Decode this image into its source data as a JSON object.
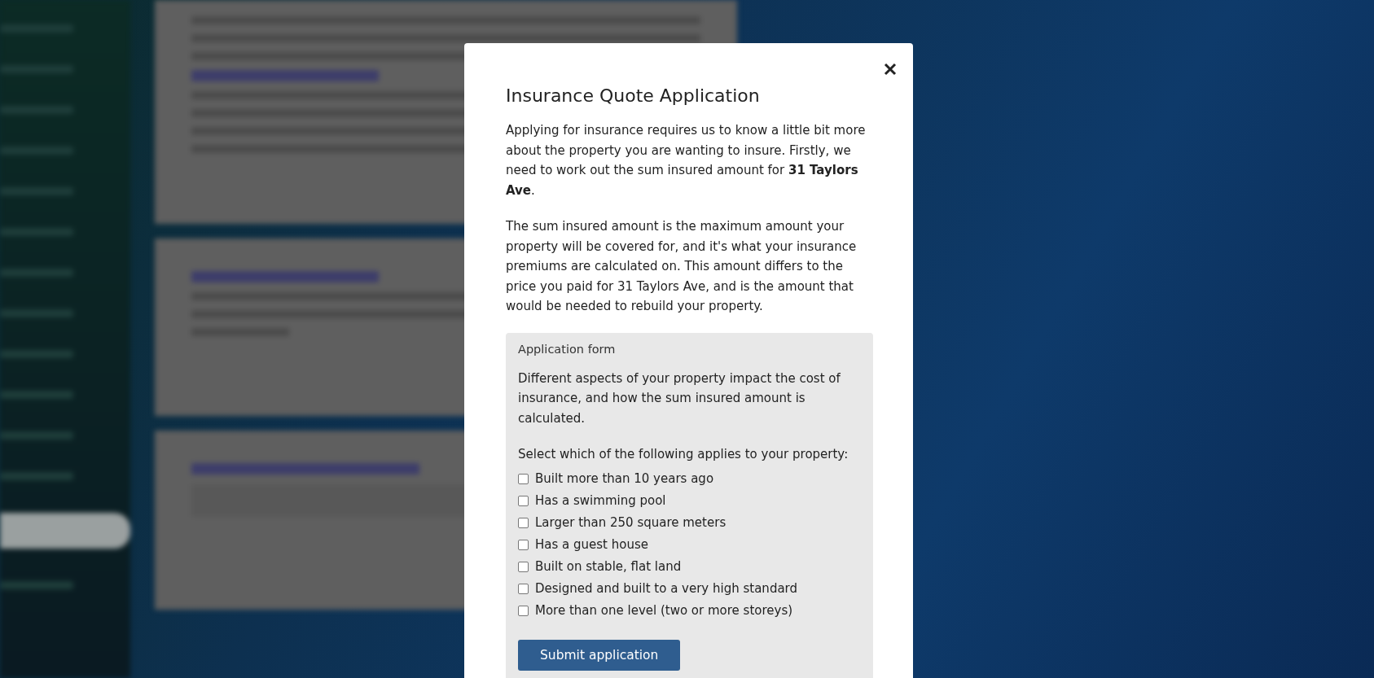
{
  "modal": {
    "title": "Insurance Quote Application",
    "paragraphs": [
      "Applying for insurance requires us to know a little bit more about the property you are wanting to insure. Firstly, we need to work out the sum insured amount for **31 Taylors Ave**.",
      "The sum insured amount is the maximum amount your property will be covered for, and it's what your insurance premiums are calculated on. This amount differs to the price you paid for 31 Taylors Ave, and is the amount that would be needed to rebuild your property."
    ],
    "form": {
      "title": "Application form",
      "intro": "Different aspects of your property impact the cost of insurance, and how the sum insured amount is calculated.",
      "prompt": "Select which of the following applies to your property:",
      "options": [
        {
          "label": "Built more than 10 years ago",
          "checked": false
        },
        {
          "label": "Has a swimming pool",
          "checked": false
        },
        {
          "label": "Larger than 250 square meters",
          "checked": false
        },
        {
          "label": "Has a guest house",
          "checked": false
        },
        {
          "label": "Built on stable, flat land",
          "checked": false
        },
        {
          "label": "Designed and built to a very high standard",
          "checked": false
        },
        {
          "label": "More than one level (two or more storeys)",
          "checked": false
        }
      ],
      "submit_label": "Submit application"
    }
  }
}
